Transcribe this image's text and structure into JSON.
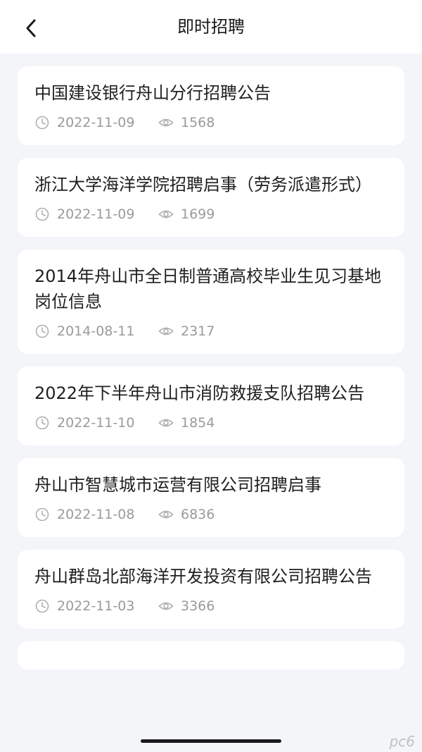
{
  "header": {
    "title": "即时招聘"
  },
  "jobs": [
    {
      "title": "中国建设银行舟山分行招聘公告",
      "date": "2022-11-09",
      "views": "1568"
    },
    {
      "title": "浙江大学海洋学院招聘启事（劳务派遣形式）",
      "date": "2022-11-09",
      "views": "1699"
    },
    {
      "title": "2014年舟山市全日制普通高校毕业生见习基地岗位信息",
      "date": "2014-08-11",
      "views": "2317"
    },
    {
      "title": "2022年下半年舟山市消防救援支队招聘公告",
      "date": "2022-11-10",
      "views": "1854"
    },
    {
      "title": "舟山市智慧城市运营有限公司招聘启事",
      "date": "2022-11-08",
      "views": "6836"
    },
    {
      "title": "舟山群岛北部海洋开发投资有限公司招聘公告",
      "date": "2022-11-03",
      "views": "3366"
    }
  ],
  "watermark": "pc6"
}
